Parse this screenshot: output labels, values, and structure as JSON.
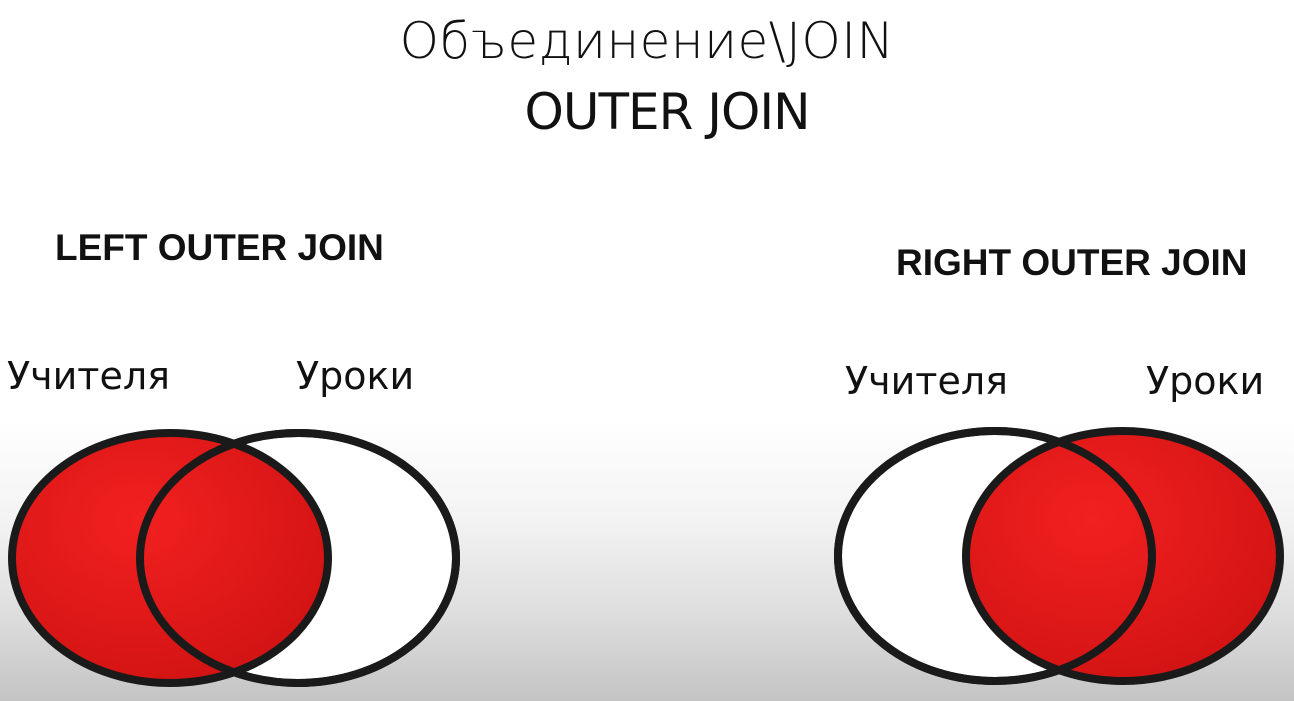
{
  "header": {
    "title": "Объединение\\JOIN",
    "subtitle": "OUTER JOIN"
  },
  "left_diagram": {
    "title": "LEFT OUTER JOIN",
    "set_a": "Учителя",
    "set_b": "Уроки",
    "highlighted": "set_a"
  },
  "right_diagram": {
    "title": "RIGHT OUTER JOIN",
    "set_a": "Учителя",
    "set_b": "Уроки",
    "highlighted": "set_b"
  },
  "colors": {
    "fill": "#e81818",
    "outline": "#1a1a1a",
    "empty": "#ffffff"
  }
}
